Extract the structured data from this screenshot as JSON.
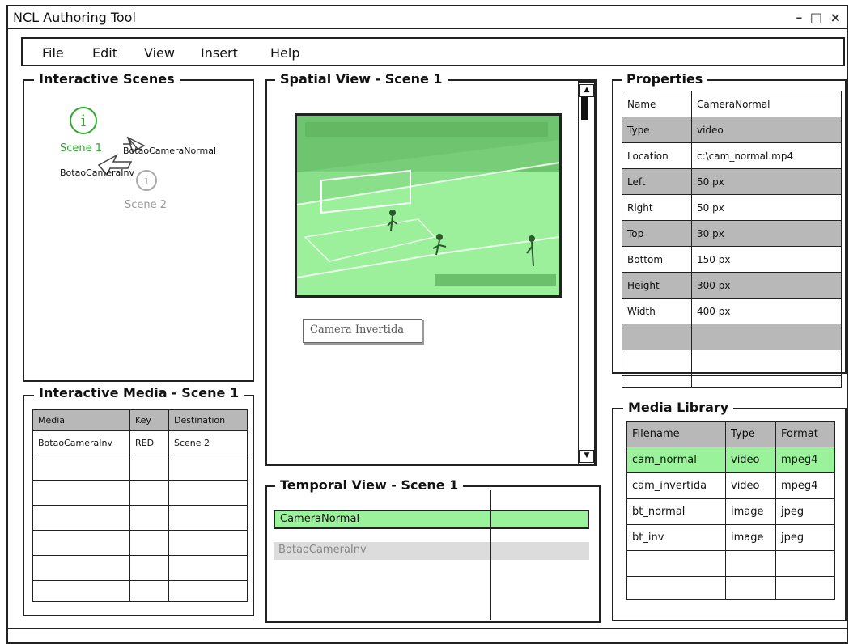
{
  "window": {
    "title": "NCL Authoring Tool",
    "controls": "– □ ×"
  },
  "menu": [
    {
      "label": "File"
    },
    {
      "label": "Edit"
    },
    {
      "label": "View"
    },
    {
      "label": "Insert"
    },
    {
      "label": "Help"
    }
  ],
  "scenes_panel": {
    "title": "Interactive Scenes",
    "scenes": [
      {
        "label": "Scene 1",
        "active": true
      },
      {
        "label": "Scene 2",
        "active": false
      }
    ],
    "links": [
      {
        "label": "BotaoCameraNormal"
      },
      {
        "label": "BotaoCameraInv"
      }
    ],
    "icon_glyph": "i"
  },
  "media_panel": {
    "title": "Interactive Media - Scene 1",
    "columns": [
      "Media",
      "Key",
      "Destination"
    ],
    "rows": [
      [
        "BotaoCameraInv",
        "RED",
        "Scene 2"
      ]
    ]
  },
  "spatial_panel": {
    "title": "Spatial View - Scene 1",
    "button_label": "Camera Invertida",
    "scroll_up": "▲",
    "scroll_down": "▼"
  },
  "temporal_panel": {
    "title": "Temporal View - Scene 1",
    "tracks": [
      {
        "label": "CameraNormal",
        "selected": true
      },
      {
        "label": "BotaoCameraInv",
        "selected": false
      }
    ]
  },
  "properties_panel": {
    "title": "Properties",
    "rows": [
      {
        "name": "Name",
        "value": "CameraNormal"
      },
      {
        "name": "Type",
        "value": "video"
      },
      {
        "name": "Location",
        "value": "c:\\cam_normal.mp4"
      },
      {
        "name": "Left",
        "value": "50 px"
      },
      {
        "name": "Right",
        "value": "50 px"
      },
      {
        "name": "Top",
        "value": "30 px"
      },
      {
        "name": "Bottom",
        "value": "150 px"
      },
      {
        "name": "Height",
        "value": "300 px"
      },
      {
        "name": "Width",
        "value": "400 px"
      }
    ]
  },
  "library_panel": {
    "title": "Media Library",
    "columns": [
      "Filename",
      "Type",
      "Format"
    ],
    "rows": [
      {
        "cells": [
          "cam_normal",
          "video",
          "mpeg4"
        ],
        "selected": true
      },
      {
        "cells": [
          "cam_invertida",
          "video",
          "mpeg4"
        ],
        "selected": false
      },
      {
        "cells": [
          "bt_normal",
          "image",
          "jpeg"
        ],
        "selected": false
      },
      {
        "cells": [
          "bt_inv",
          "image",
          "jpeg"
        ],
        "selected": false
      }
    ]
  },
  "colors": {
    "selection_green": "#9af39a",
    "inactive_gray": "#b8b8b8",
    "scene_green": "#2fa82f"
  }
}
